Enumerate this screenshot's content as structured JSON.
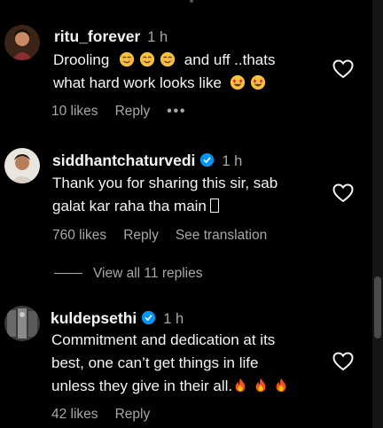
{
  "comments": [
    {
      "username": "ritu_forever",
      "time": "1 h",
      "line1_text": "Drooling",
      "line1_tail": "and uff ..thats",
      "line2_text": "what hard work looks like",
      "likes": "10 likes",
      "reply": "Reply",
      "more": "•••"
    },
    {
      "username": "siddhantchaturvedi",
      "time": "1 h",
      "verified": true,
      "line1": "Thank you for sharing this sir, sab",
      "line2": "galat kar raha tha main",
      "likes": "760 likes",
      "reply": "Reply",
      "translate": "See translation"
    },
    {
      "username": "kuldepsethi",
      "time": "1 h",
      "verified": true,
      "line1": "Commitment and dedication at its",
      "line2": "best, one can’t get things in life",
      "line3": "unless they give in their all.",
      "likes": "42 likes",
      "reply": "Reply"
    }
  ],
  "view_replies": "View all 11 replies",
  "icons": {
    "heart": "heart-outline-icon",
    "verified": "verified-badge-icon",
    "smile": "smiling-face-emoji",
    "heart_eyes": "heart-eyes-emoji",
    "fire": "fire-emoji"
  },
  "colors": {
    "background": "#000000",
    "text": "#f5f5f5",
    "secondary": "#a8a8a8",
    "verified": "#0095f6"
  }
}
